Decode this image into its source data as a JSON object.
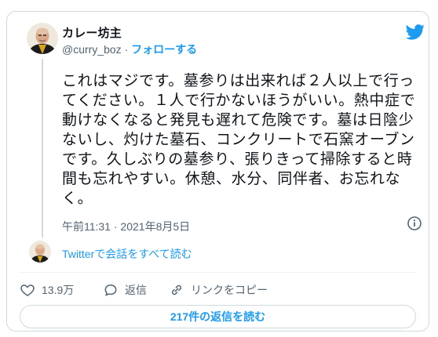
{
  "author": {
    "name": "カレー坊主",
    "handle": "@curry_boz",
    "separator": "·",
    "follow_label": "フォローする"
  },
  "tweet": {
    "text": "これはマジです。墓参りは出来れば２人以上で行ってください。１人で行かないほうがいい。熱中症で動けなくなると発見も遅れて危険です。墓は日陰少ないし、灼けた墓石、コンクリートで石窯オーブンです。久しぶりの墓参り、張りきって掃除すると時間も忘れやすい。休憩、水分、同伴者、お忘れなく。",
    "timestamp": "午前11:31 · 2021年8月5日"
  },
  "conversation_link": "Twitterで会話をすべて読む",
  "actions": {
    "likes": "13.9万",
    "reply": "返信",
    "copy_link": "リンクをコピー"
  },
  "replies_button": "217件の返信を読む",
  "icons": {
    "brand": "twitter-bird-icon",
    "info": "info-icon",
    "like": "heart-icon",
    "reply": "reply-bubble-icon",
    "copy": "link-icon"
  },
  "colors": {
    "accent": "#1d9bf0",
    "text": "#0f1419",
    "muted": "#536471",
    "border": "#cfd9de"
  }
}
